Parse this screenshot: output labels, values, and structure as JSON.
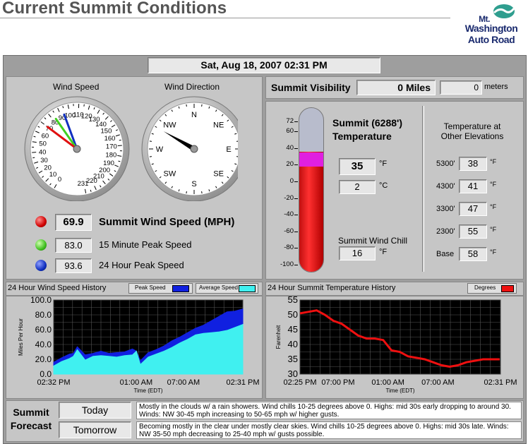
{
  "page": {
    "title": "Current Summit Conditions"
  },
  "logo": {
    "line1": "Mt.",
    "line2": "Washington",
    "line3": "Auto Road"
  },
  "datetime": "Sat, Aug 18, 2007  02:31 PM",
  "wind_speed_gauge": {
    "title": "Wind Speed",
    "scale_labels": [
      "0",
      "10",
      "20",
      "30",
      "40",
      "50",
      "60",
      "70",
      "80",
      "90",
      "100",
      "110",
      "120",
      "130",
      "140",
      "150",
      "160",
      "170",
      "180",
      "190",
      "200",
      "210",
      "220",
      "231"
    ],
    "needles": {
      "current": 69.9,
      "peak_15min": 83.0,
      "peak_24hr": 93.6
    },
    "max": 231
  },
  "wind_direction_gauge": {
    "title": "Wind Direction",
    "labels": [
      "N",
      "NE",
      "E",
      "SE",
      "S",
      "SW",
      "W",
      "NW"
    ],
    "direction_deg": 300
  },
  "wind": {
    "current_value": "69.9",
    "current_label": "Summit Wind Speed (MPH)",
    "peak15_value": "83.0",
    "peak15_label": "15 Minute Peak Speed",
    "peak24_value": "93.6",
    "peak24_label": "24 Hour Peak Speed",
    "colors": {
      "current": "#e01010",
      "peak15": "#40d020",
      "peak24": "#1030c0"
    }
  },
  "visibility": {
    "label": "Summit Visibility",
    "miles": "0 Miles",
    "meters_value": "0",
    "meters_unit": "meters"
  },
  "thermometer": {
    "scale": [
      "72",
      "60",
      "40",
      "20",
      "0",
      "-20",
      "-40",
      "-60",
      "-80",
      "-100"
    ],
    "value_f": 35,
    "min": -100,
    "max": 72
  },
  "summit_temp": {
    "title_line1": "Summit (6288')",
    "title_line2": "Temperature",
    "f_value": "35",
    "f_unit": "°F",
    "c_value": "2",
    "c_unit": "°C",
    "wind_chill_label": "Summit Wind Chill",
    "wind_chill_value": "16",
    "wind_chill_unit": "°F"
  },
  "elevations": {
    "title_line1": "Temperature at",
    "title_line2": "Other Elevations",
    "rows": [
      {
        "elev": "5300'",
        "value": "38",
        "unit": "°F"
      },
      {
        "elev": "4300'",
        "value": "41",
        "unit": "°F"
      },
      {
        "elev": "3300'",
        "value": "47",
        "unit": "°F"
      },
      {
        "elev": "2300'",
        "value": "55",
        "unit": "°F"
      },
      {
        "elev": "Base",
        "value": "58",
        "unit": "°F"
      }
    ]
  },
  "wind_chart_header": {
    "title": "24 Hour Wind Speed History",
    "legend_peak": "Peak Speed",
    "legend_avg": "Average Speed"
  },
  "temp_chart_header": {
    "title": "24 Hour Summit Temperature History",
    "legend": "Degrees"
  },
  "chart_data": [
    {
      "type": "area",
      "title": "24 Hour Wind Speed History",
      "xlabel": "Time (EDT)",
      "ylabel": "Miles Per Hour",
      "ylim": [
        0,
        100
      ],
      "y_ticks": [
        "0.0",
        "20.0",
        "40.0",
        "60.0",
        "80.0",
        "100.0"
      ],
      "x_ticks": [
        "02:32 PM",
        "01:00 AM",
        "07:00 AM",
        "02:31 PM"
      ],
      "x_hours": [
        0,
        10.47,
        16.47,
        24
      ],
      "series": [
        {
          "name": "Peak Speed",
          "color": "#1020e0",
          "x": [
            0,
            1,
            2,
            2.5,
            3,
            4,
            5,
            6,
            7,
            8,
            9,
            10,
            10.5,
            11,
            12,
            13,
            14,
            15,
            16,
            17,
            18,
            19,
            20,
            21,
            22,
            23,
            24
          ],
          "values": [
            16,
            22,
            27,
            28,
            37,
            26,
            28,
            31,
            28,
            29,
            30,
            34,
            31,
            18,
            29,
            33,
            38,
            45,
            50,
            56,
            62,
            66,
            72,
            78,
            84,
            85,
            88
          ]
        },
        {
          "name": "Average Speed",
          "color": "#40f0f0",
          "x": [
            0,
            1,
            2,
            2.5,
            3,
            4,
            5,
            6,
            7,
            8,
            9,
            10,
            10.5,
            11,
            12,
            13,
            14,
            15,
            16,
            17,
            18,
            19,
            20,
            21,
            22,
            23,
            24
          ],
          "values": [
            11,
            17,
            21,
            24,
            33,
            19,
            24,
            25,
            24,
            23,
            25,
            26,
            31,
            13,
            23,
            27,
            31,
            36,
            42,
            47,
            53,
            55,
            56,
            57,
            59,
            63,
            67
          ]
        }
      ]
    },
    {
      "type": "line",
      "title": "24 Hour Summit Temperature History",
      "xlabel": "Time (EDT)",
      "ylabel": "Farenheit",
      "ylim": [
        30,
        55
      ],
      "y_ticks": [
        "30",
        "35",
        "40",
        "45",
        "50",
        "55"
      ],
      "x_ticks": [
        "02:25 PM",
        "07:00 PM",
        "01:00 AM",
        "07:00 AM",
        "02:31 PM"
      ],
      "x_hours": [
        0,
        4.58,
        10.58,
        16.58,
        24.1
      ],
      "series": [
        {
          "name": "Degrees",
          "color": "#ee1010",
          "x": [
            0,
            1,
            2,
            3,
            4,
            5,
            6,
            7,
            8,
            9,
            10,
            11,
            12,
            13,
            14,
            15,
            16,
            17,
            18,
            19,
            20,
            21,
            22,
            23,
            24
          ],
          "values": [
            50.5,
            51,
            51.5,
            50,
            48,
            47,
            45,
            43,
            42,
            42,
            41.5,
            38,
            37.5,
            36,
            35.5,
            35,
            34,
            33,
            32.5,
            33,
            34,
            34.5,
            35,
            35,
            35
          ]
        }
      ]
    }
  ],
  "forecast": {
    "label_line1": "Summit",
    "label_line2": "Forecast",
    "today_label": "Today",
    "tomorrow_label": "Tomorrow",
    "today_text": "Mostly in the clouds w/ a rain showers.  Wind chills 10-25 degrees above 0.  Highs: mid 30s early dropping to around 30.  Winds: NW 30-45 mph increasing to 50-65 mph w/ higher gusts.",
    "tomorrow_text": "Becoming mostly in the clear under mostly clear skies.  Wind chills 10-25 degrees above 0.  Highs: mid 30s late.  Winds: NW 35-50 mph decreasing to 25-40 mph w/ gusts possible."
  }
}
